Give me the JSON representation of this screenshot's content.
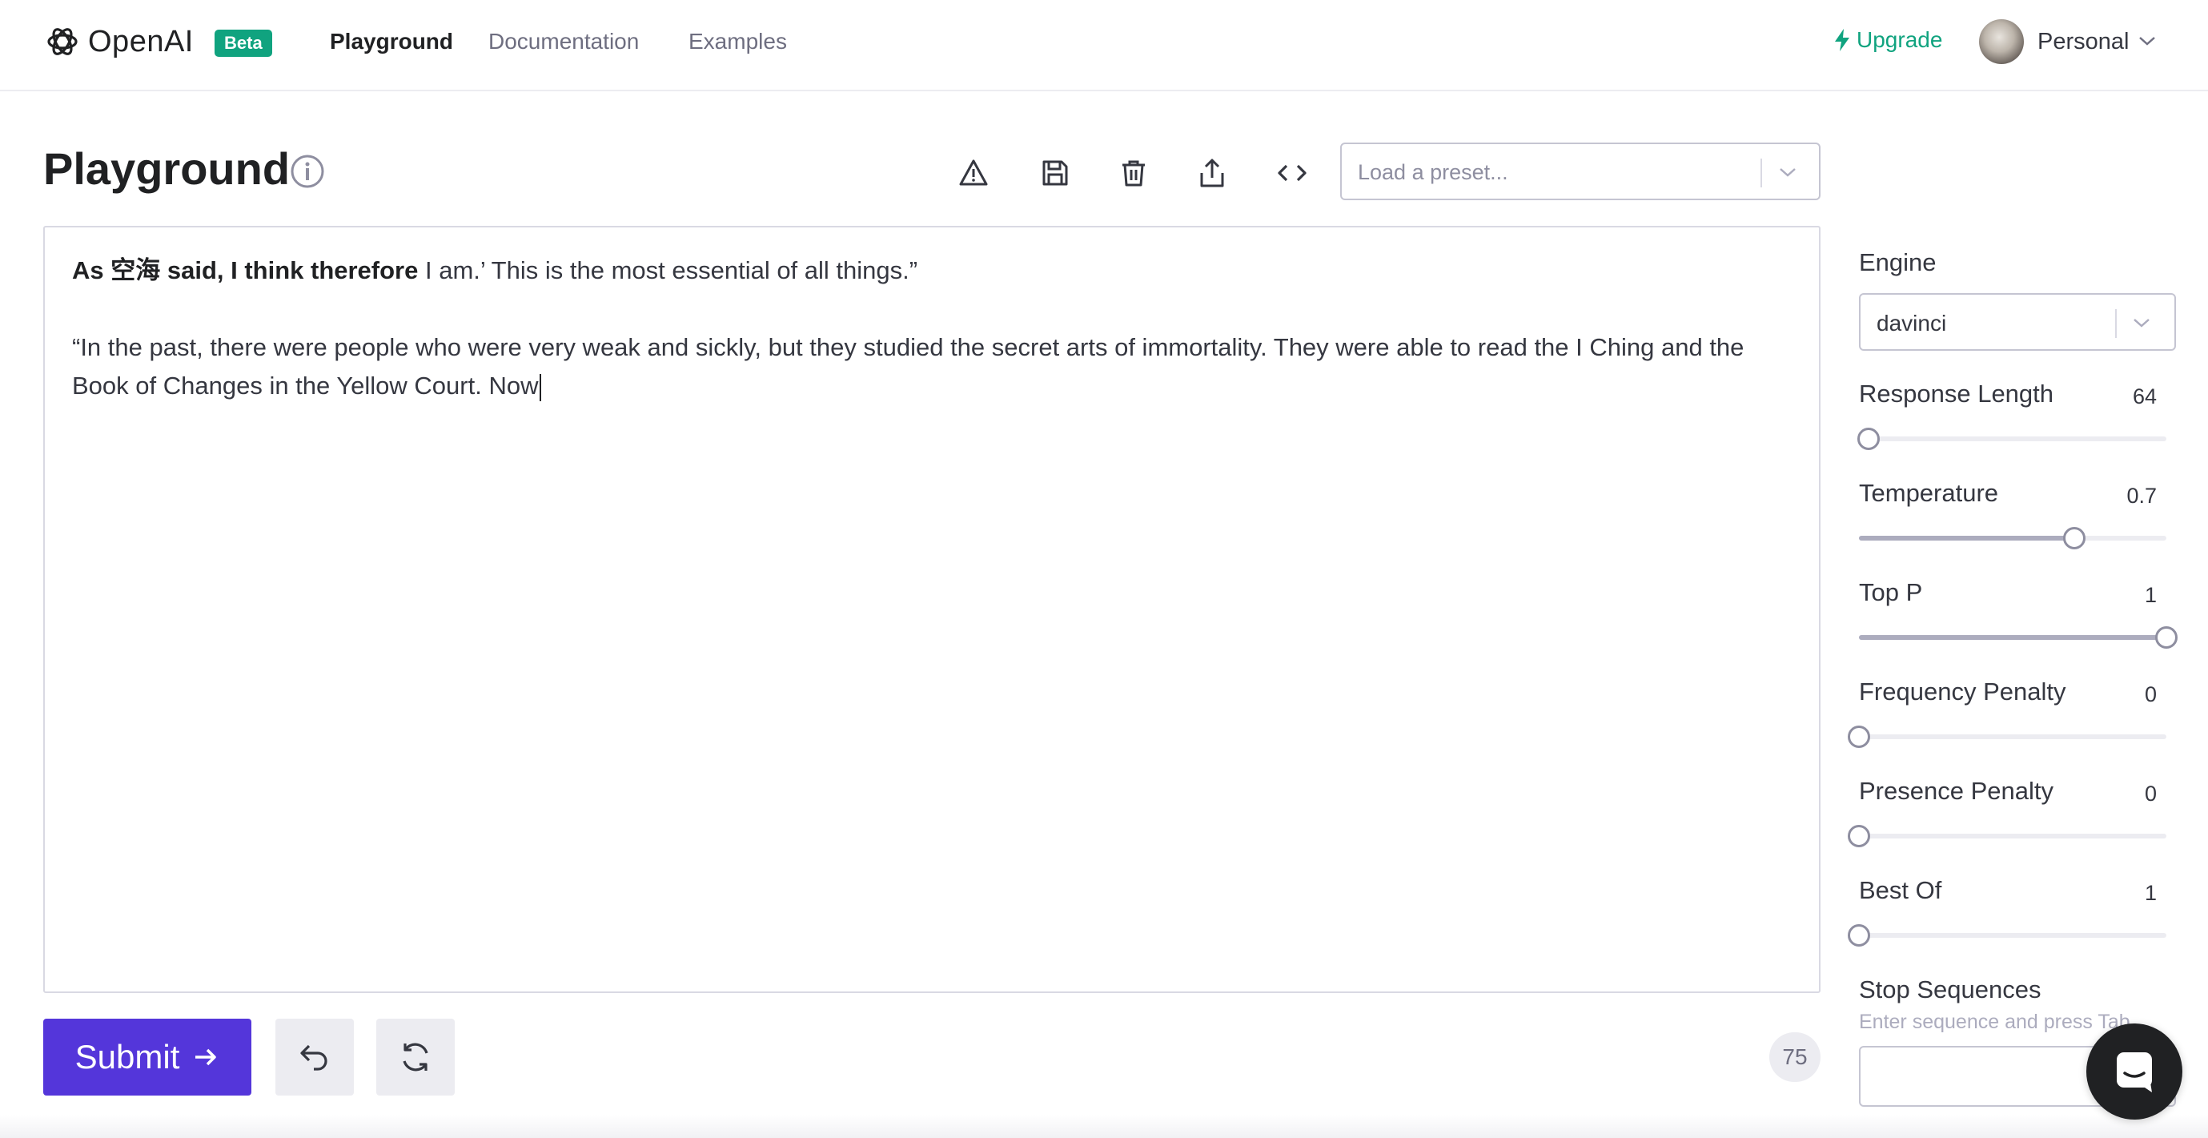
{
  "nav": {
    "logo_text": "OpenAI",
    "beta_badge": "Beta",
    "links": [
      {
        "label": "Playground",
        "active": true
      },
      {
        "label": "Documentation",
        "active": false
      },
      {
        "label": "Examples",
        "active": false
      }
    ],
    "upgrade_label": "Upgrade",
    "account_label": "Personal"
  },
  "header": {
    "title": "Playground",
    "toolbar_icons": [
      "warning-icon",
      "save-icon",
      "trash-icon",
      "share-icon",
      "code-icon"
    ],
    "preset_placeholder": "Load a preset..."
  },
  "editor": {
    "line1_bold": "As 空海 said, I think therefore",
    "line1_rest": " I am.’ This is the most essential of all things.”",
    "paragraph2": "“In the past, there were people who were very weak and sickly, but they studied the secret arts of immortality. They were able to read the I Ching and the Book of Changes in the Yellow Court. Now"
  },
  "actions": {
    "submit_label": "Submit",
    "undo_icon": "undo-icon",
    "regenerate_icon": "regenerate-icon",
    "token_count": "75"
  },
  "settings": {
    "engine_label": "Engine",
    "engine_value": "davinci",
    "sliders": [
      {
        "label": "Response Length",
        "value": "64",
        "fraction": 0.03
      },
      {
        "label": "Temperature",
        "value": "0.7",
        "fraction": 0.7
      },
      {
        "label": "Top P",
        "value": "1",
        "fraction": 1.0
      },
      {
        "label": "Frequency Penalty",
        "value": "0",
        "fraction": 0.0
      },
      {
        "label": "Presence Penalty",
        "value": "0",
        "fraction": 0.0
      },
      {
        "label": "Best Of",
        "value": "1",
        "fraction": 0.0
      }
    ],
    "stop_label": "Stop Sequences",
    "stop_hint": "Enter sequence and press Tab"
  },
  "colors": {
    "accent": "#10a37f",
    "submit": "#5436da"
  }
}
